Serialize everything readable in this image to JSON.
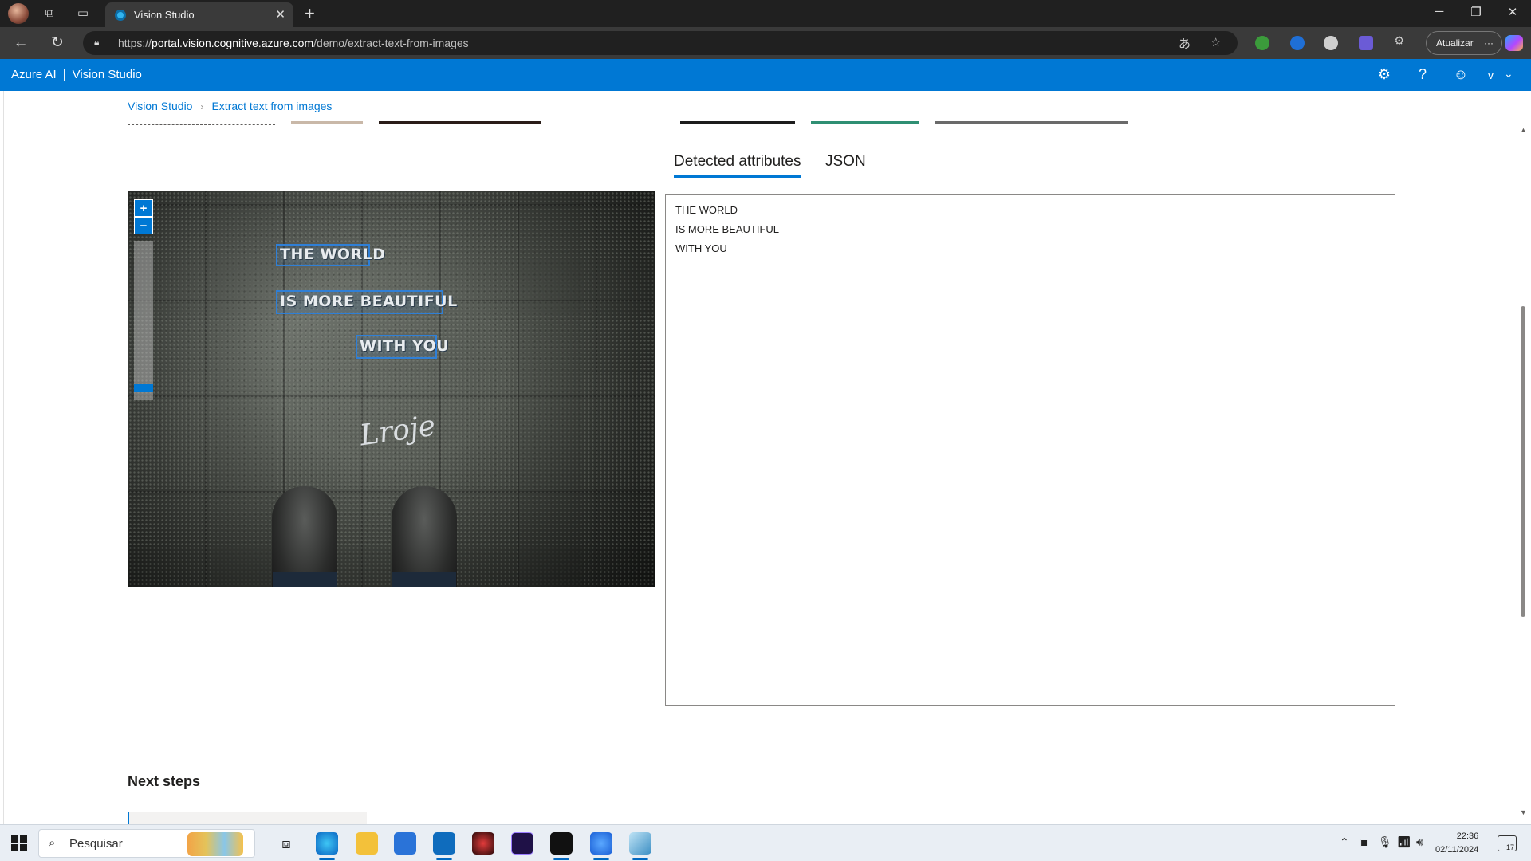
{
  "browser": {
    "tab_title": "Vision Studio",
    "url_host": "portal.vision.cognitive.azure.com",
    "url_prefix": "https://",
    "url_path": "/demo/extract-text-from-images",
    "update_button": "Atualizar",
    "update_dots": "···"
  },
  "header": {
    "brand_azure": "Azure AI",
    "brand_sep": "|",
    "brand_app": "Vision Studio",
    "user_initial": "v"
  },
  "breadcrumb": {
    "root": "Vision Studio",
    "current": "Extract text from images"
  },
  "tabs": [
    {
      "label": "Detected attributes",
      "active": true
    },
    {
      "label": "JSON",
      "active": false
    }
  ],
  "image": {
    "ocr_lines": [
      "THE WORLD",
      "IS MORE BEAUTIFUL",
      "WITH YOU"
    ],
    "signature": "Lroje",
    "zoom_in": "+",
    "zoom_out": "−"
  },
  "results": {
    "lines": [
      "THE WORLD",
      "IS MORE BEAUTIFUL",
      "WITH YOU"
    ]
  },
  "next_steps": {
    "title": "Next steps"
  },
  "taskbar": {
    "search_placeholder": "Pesquisar",
    "time": "22:36",
    "date": "02/11/2024",
    "notifications": "17"
  },
  "colors": {
    "accent": "#0078d4",
    "header_bg": "#0078d4",
    "browser_dark": "#202020"
  }
}
